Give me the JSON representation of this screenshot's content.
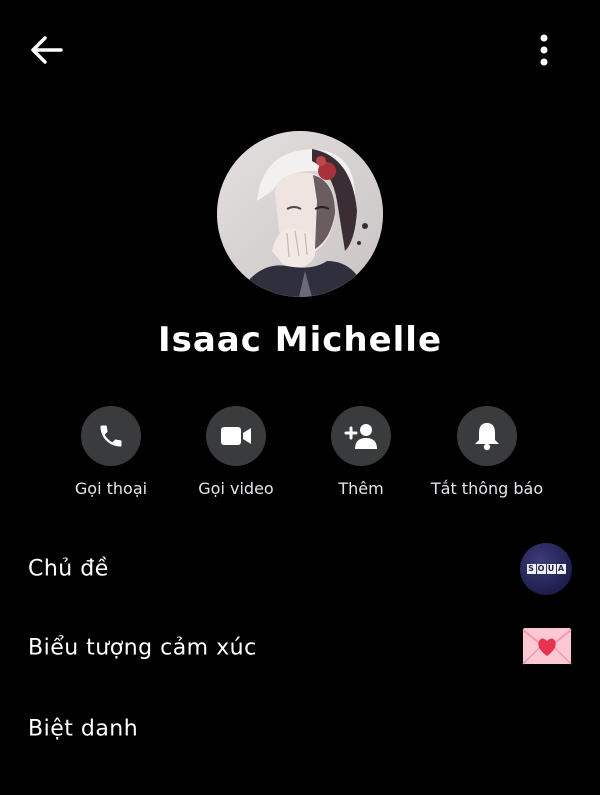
{
  "header": {
    "back_icon": "arrow-left-icon",
    "more_icon": "more-vertical-icon"
  },
  "profile": {
    "name": "Isaac Michelle"
  },
  "actions": [
    {
      "id": "call",
      "label": "Gọi thoại",
      "icon": "phone-icon"
    },
    {
      "id": "video",
      "label": "Gọi video",
      "icon": "video-camera-icon"
    },
    {
      "id": "add",
      "label": "Thêm",
      "icon": "add-person-icon"
    },
    {
      "id": "mute",
      "label": "Tắt thông báo",
      "icon": "bell-icon"
    }
  ],
  "settings": [
    {
      "id": "theme",
      "label": "Chủ đề"
    },
    {
      "id": "emoji",
      "label": "Biểu tượng cảm xúc"
    },
    {
      "id": "nickname",
      "label": "Biệt danh"
    }
  ],
  "theme_tiles": [
    "S",
    "O",
    "U",
    "A"
  ],
  "colors": {
    "background": "#000000",
    "circle_button": "#3a3b3c",
    "text": "#ffffff"
  }
}
